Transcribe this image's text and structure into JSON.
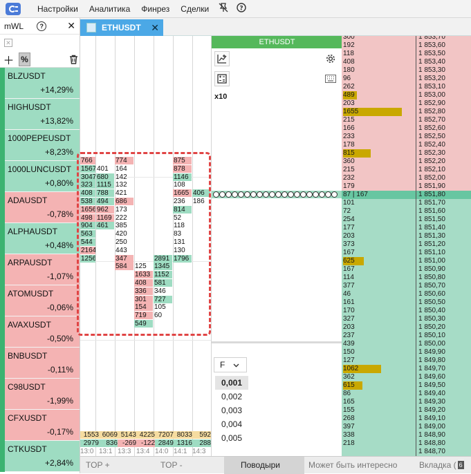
{
  "menu": {
    "items": [
      "Настройки",
      "Аналитика",
      "Финрез",
      "Сделки"
    ]
  },
  "watchlist": {
    "title": "mWL",
    "items": [
      {
        "symbol": "BLZUSDT",
        "change": "+14,29%",
        "dir": "up"
      },
      {
        "symbol": "HIGHUSDT",
        "change": "+13,82%",
        "dir": "up"
      },
      {
        "symbol": "1000PEPEUSDT",
        "change": "+8,23%",
        "dir": "up"
      },
      {
        "symbol": "1000LUNCUSDT",
        "change": "+0,80%",
        "dir": "up"
      },
      {
        "symbol": "ADAUSDT",
        "change": "-0,78%",
        "dir": "down"
      },
      {
        "symbol": "ALPHAUSDT",
        "change": "+0,48%",
        "dir": "up"
      },
      {
        "symbol": "ARPAUSDT",
        "change": "-1,07%",
        "dir": "down"
      },
      {
        "symbol": "ATOMUSDT",
        "change": "-0,06%",
        "dir": "down"
      },
      {
        "symbol": "AVAXUSDT",
        "change": "-0,50%",
        "dir": "down"
      },
      {
        "symbol": "BNBUSDT",
        "change": "-0,11%",
        "dir": "down"
      },
      {
        "symbol": "C98USDT",
        "change": "-1,99%",
        "dir": "down"
      },
      {
        "symbol": "CFXUSDT",
        "change": "-0,17%",
        "dir": "down"
      },
      {
        "symbol": "CTKUSDT",
        "change": "+2,84%",
        "dir": "up"
      }
    ]
  },
  "tab": {
    "label": "ETHUSDT"
  },
  "chart": {
    "title": "ETHUSDT",
    "multiplier": "x10",
    "filter_label": "F",
    "filter_options": [
      "0,001",
      "0,002",
      "0,003",
      "0,004",
      "0,005"
    ]
  },
  "cluster": {
    "columns": [
      {
        "cells": [
          {
            "v": "766",
            "t": "r"
          },
          {
            "v": "1567",
            "t": "g"
          },
          {
            "v": "3047",
            "t": "g"
          },
          {
            "v": "323",
            "t": "g"
          },
          {
            "v": "408",
            "t": "g"
          },
          {
            "v": "538",
            "t": "g"
          },
          {
            "v": "1656",
            "t": "r"
          },
          {
            "v": "498",
            "t": "r"
          },
          {
            "v": "904",
            "t": "g"
          },
          {
            "v": "563",
            "t": "g"
          },
          {
            "v": "544",
            "t": "g"
          },
          {
            "v": "2164",
            "t": "r"
          },
          {
            "v": "1256",
            "t": "g"
          }
        ],
        "start": 0
      },
      {
        "cells": [
          {
            "v": "401",
            "t": "w"
          },
          {
            "v": "680",
            "t": "g"
          },
          {
            "v": "1115",
            "t": "g"
          },
          {
            "v": "788",
            "t": "g"
          },
          {
            "v": "494",
            "t": "g"
          },
          {
            "v": "962",
            "t": "r"
          },
          {
            "v": "1169",
            "t": "r"
          },
          {
            "v": "461",
            "t": "g"
          }
        ],
        "start": 1
      },
      {
        "cells": [
          {
            "v": "774",
            "t": "r"
          },
          {
            "v": "164",
            "t": "w"
          },
          {
            "v": "142",
            "t": "w"
          },
          {
            "v": "132",
            "t": "w"
          },
          {
            "v": "421",
            "t": "w"
          },
          {
            "v": "686",
            "t": "r"
          },
          {
            "v": "173",
            "t": "w"
          },
          {
            "v": "222",
            "t": "w"
          },
          {
            "v": "385",
            "t": "w"
          },
          {
            "v": "420",
            "t": "w"
          },
          {
            "v": "250",
            "t": "w"
          },
          {
            "v": "443",
            "t": "w"
          },
          {
            "v": "347",
            "t": "r"
          },
          {
            "v": "584",
            "t": "r"
          }
        ],
        "start": 0
      },
      {
        "cells": [
          {
            "v": "125",
            "t": "w"
          },
          {
            "v": "1633",
            "t": "r"
          },
          {
            "v": "408",
            "t": "r"
          },
          {
            "v": "336",
            "t": "r"
          },
          {
            "v": "301",
            "t": "r"
          },
          {
            "v": "154",
            "t": "r"
          },
          {
            "v": "719",
            "t": "r"
          },
          {
            "v": "549",
            "t": "g"
          }
        ],
        "start": 13
      },
      {
        "cells": [
          {
            "v": "2891",
            "t": "g"
          },
          {
            "v": "1345",
            "t": "g"
          },
          {
            "v": "1152",
            "t": "g"
          },
          {
            "v": "581",
            "t": "g"
          },
          {
            "v": "346",
            "t": "w"
          },
          {
            "v": "727",
            "t": "g"
          },
          {
            "v": "105",
            "t": "w"
          },
          {
            "v": "60",
            "t": "w"
          }
        ],
        "start": 12
      },
      {
        "cells": [
          {
            "v": "875",
            "t": "r"
          },
          {
            "v": "878",
            "t": "r"
          },
          {
            "v": "1146",
            "t": "g"
          },
          {
            "v": "108",
            "t": "w"
          },
          {
            "v": "1665",
            "t": "r"
          },
          {
            "v": "236",
            "t": "w"
          },
          {
            "v": "814",
            "t": "g"
          },
          {
            "v": "52",
            "t": "w"
          },
          {
            "v": "118",
            "t": "w"
          },
          {
            "v": "83",
            "t": "w"
          },
          {
            "v": "131",
            "t": "w"
          },
          {
            "v": "130",
            "t": "w"
          },
          {
            "v": "1796",
            "t": "g"
          }
        ],
        "start": 0
      },
      {
        "cells": [
          {
            "v": "406",
            "t": "g"
          },
          {
            "v": "186",
            "t": "w"
          }
        ],
        "start": 4
      }
    ],
    "totals_row1": [
      "1553",
      "6069",
      "5143",
      "4225",
      "7207",
      "8033",
      "592"
    ],
    "totals_row2": [
      "2979",
      "836",
      "-269",
      "-122",
      "2849",
      "1316",
      "288"
    ],
    "times": [
      "13:0",
      "13:1",
      "13:3",
      "13:4",
      "14:0",
      "14:1",
      "14:3"
    ]
  },
  "bottom_tabs": [
    "TOP +",
    "TOP -",
    "Поводыри",
    "Может быть интересно",
    "Вкладка ("
  ],
  "bottom_badge": "6",
  "orderbook": {
    "rows": [
      {
        "vol": "300",
        "price": "1 853,70",
        "side": "ask",
        "bar": 0
      },
      {
        "vol": "192",
        "price": "1 853,60",
        "side": "ask",
        "bar": 0
      },
      {
        "vol": "118",
        "price": "1 853,50",
        "side": "ask",
        "bar": 0
      },
      {
        "vol": "408",
        "price": "1 853,40",
        "side": "ask",
        "bar": 0
      },
      {
        "vol": "180",
        "price": "1 853,30",
        "side": "ask",
        "bar": 0
      },
      {
        "vol": "96",
        "price": "1 853,20",
        "side": "ask",
        "bar": 0
      },
      {
        "vol": "262",
        "price": "1 853,10",
        "side": "ask",
        "bar": 0
      },
      {
        "vol": "489",
        "price": "1 853,00",
        "side": "ask",
        "bar": 20
      },
      {
        "vol": "203",
        "price": "1 852,90",
        "side": "ask",
        "bar": 0
      },
      {
        "vol": "1655",
        "price": "1 852,80",
        "side": "ask",
        "bar": 85
      },
      {
        "vol": "215",
        "price": "1 852,70",
        "side": "ask",
        "bar": 0
      },
      {
        "vol": "166",
        "price": "1 852,60",
        "side": "ask",
        "bar": 0
      },
      {
        "vol": "233",
        "price": "1 852,50",
        "side": "ask",
        "bar": 0
      },
      {
        "vol": "178",
        "price": "1 852,40",
        "side": "ask",
        "bar": 0
      },
      {
        "vol": "815",
        "price": "1 852,30",
        "side": "ask",
        "bar": 40
      },
      {
        "vol": "360",
        "price": "1 852,20",
        "side": "ask",
        "bar": 0
      },
      {
        "vol": "215",
        "price": "1 852,10",
        "side": "ask",
        "bar": 0
      },
      {
        "vol": "232",
        "price": "1 852,00",
        "side": "ask",
        "bar": 0
      },
      {
        "vol": "179",
        "price": "1 851,90",
        "side": "ask",
        "bar": 0
      },
      {
        "vol": "87 | 167",
        "price": "1 851,80",
        "side": "cur",
        "bar": 0
      },
      {
        "vol": "101",
        "price": "1 851,70",
        "side": "bid",
        "bar": 0
      },
      {
        "vol": "72",
        "price": "1 851,60",
        "side": "bid",
        "bar": 0
      },
      {
        "vol": "254",
        "price": "1 851,50",
        "side": "bid",
        "bar": 0
      },
      {
        "vol": "177",
        "price": "1 851,40",
        "side": "bid",
        "bar": 0
      },
      {
        "vol": "203",
        "price": "1 851,30",
        "side": "bid",
        "bar": 0
      },
      {
        "vol": "373",
        "price": "1 851,20",
        "side": "bid",
        "bar": 0
      },
      {
        "vol": "167",
        "price": "1 851,10",
        "side": "bid",
        "bar": 0
      },
      {
        "vol": "625",
        "price": "1 851,00",
        "side": "bid",
        "bar": 30
      },
      {
        "vol": "167",
        "price": "1 850,90",
        "side": "bid",
        "bar": 0
      },
      {
        "vol": "114",
        "price": "1 850,80",
        "side": "bid",
        "bar": 0
      },
      {
        "vol": "377",
        "price": "1 850,70",
        "side": "bid",
        "bar": 0
      },
      {
        "vol": "46",
        "price": "1 850,60",
        "side": "bid",
        "bar": 0
      },
      {
        "vol": "161",
        "price": "1 850,50",
        "side": "bid",
        "bar": 0
      },
      {
        "vol": "170",
        "price": "1 850,40",
        "side": "bid",
        "bar": 0
      },
      {
        "vol": "327",
        "price": "1 850,30",
        "side": "bid",
        "bar": 0
      },
      {
        "vol": "203",
        "price": "1 850,20",
        "side": "bid",
        "bar": 0
      },
      {
        "vol": "237",
        "price": "1 850,10",
        "side": "bid",
        "bar": 0
      },
      {
        "vol": "439",
        "price": "1 850,00",
        "side": "bid",
        "bar": 0
      },
      {
        "vol": "150",
        "price": "1 849,90",
        "side": "bid",
        "bar": 0
      },
      {
        "vol": "127",
        "price": "1 849,80",
        "side": "bid",
        "bar": 0
      },
      {
        "vol": "1062",
        "price": "1 849,70",
        "side": "bid",
        "bar": 55
      },
      {
        "vol": "362",
        "price": "1 849,60",
        "side": "bid",
        "bar": 0
      },
      {
        "vol": "615",
        "price": "1 849,50",
        "side": "bid",
        "bar": 28
      },
      {
        "vol": "86",
        "price": "1 849,40",
        "side": "bid",
        "bar": 0
      },
      {
        "vol": "165",
        "price": "1 849,30",
        "side": "bid",
        "bar": 0
      },
      {
        "vol": "155",
        "price": "1 849,20",
        "side": "bid",
        "bar": 0
      },
      {
        "vol": "268",
        "price": "1 849,10",
        "side": "bid",
        "bar": 0
      },
      {
        "vol": "397",
        "price": "1 849,00",
        "side": "bid",
        "bar": 0
      },
      {
        "vol": "338",
        "price": "1 848,90",
        "side": "bid",
        "bar": 0
      },
      {
        "vol": "218",
        "price": "1 848,80",
        "side": "bid",
        "bar": 0
      },
      {
        "vol": "",
        "price": "1 848,70",
        "side": "bid",
        "bar": 0
      }
    ]
  },
  "colors": {
    "ask": "#f2c5c5",
    "bid": "#a6dcc6",
    "accent": "#4ba8e6",
    "bar": "#c9a800",
    "chart_title": "#55b85b"
  }
}
